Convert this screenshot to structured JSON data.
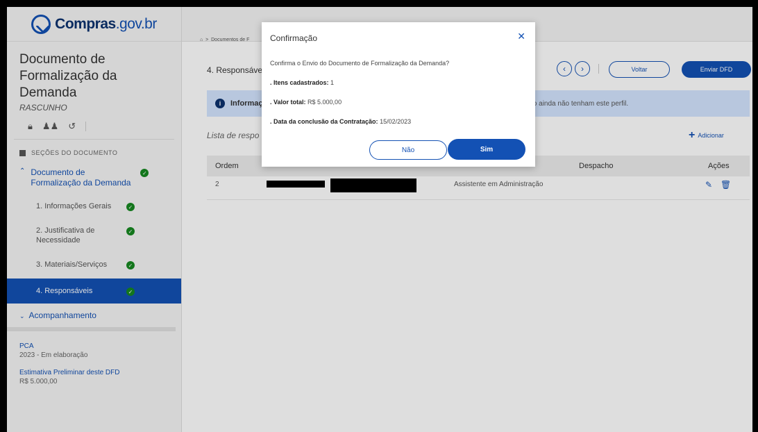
{
  "logo": {
    "brand": "Compras",
    "domain": ".gov.br"
  },
  "sidebar": {
    "title": "Documento de Formalização da Demanda",
    "status": "RASCUNHO",
    "sections_header": "SEÇÕES DO DOCUMENTO",
    "main_item": "Documento de Formalização da Demanda",
    "items": [
      {
        "label": "1. Informações Gerais"
      },
      {
        "label": "2. Justificativa de Necessidade"
      },
      {
        "label": "3. Materiais/Serviços"
      },
      {
        "label": "4. Responsáveis"
      }
    ],
    "acompanhamento": "Acompanhamento",
    "pca_title": "PCA",
    "pca_value": "2023 - Em elaboração",
    "estimativa_title": "Estimativa Preliminar deste DFD",
    "estimativa_value": "R$ 5.000,00"
  },
  "main": {
    "breadcrumb": "Documentos de F",
    "page_heading": "4. Responsáve",
    "voltar_label": "Voltar",
    "enviar_label": "Enviar DFD",
    "info_title": "Informaç",
    "info_tail": "fato, caso ainda não tenham este perfil.",
    "list_label": "Lista de respo",
    "adicionar_label": "Adicionar",
    "table": {
      "headers": [
        "Ordem",
        "Despacho",
        "Ações"
      ],
      "rows": [
        {
          "ordem": "2",
          "cargo": "Assistente em Administração"
        }
      ]
    }
  },
  "modal": {
    "title": "Confirmação",
    "question": "Confirma o Envio do Documento de Formalização da Demanda?",
    "itens_label": ". Itens cadastrados:",
    "itens_value": "1",
    "valor_label": ". Valor total:",
    "valor_value": "R$ 5.000,00",
    "data_label": ". Data da conclusão da Contratação:",
    "data_value": "15/02/2023",
    "no_label": "Não",
    "yes_label": "Sim"
  },
  "colors": {
    "accent": "#1351b4",
    "success": "#168821",
    "info_bg": "#d4e5ff"
  }
}
